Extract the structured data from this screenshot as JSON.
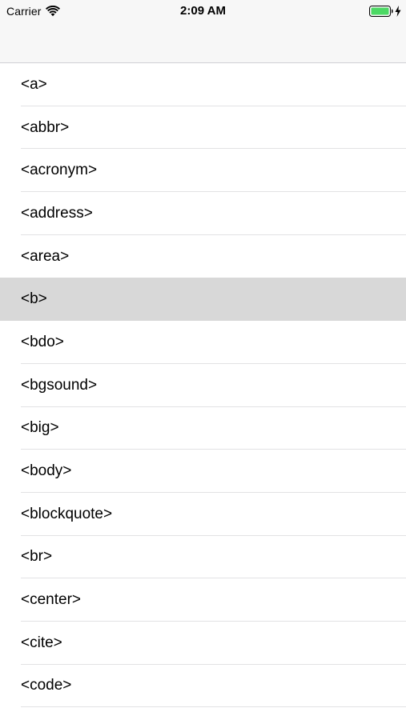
{
  "status_bar": {
    "carrier": "Carrier",
    "time": "2:09 AM",
    "icons": {
      "wifi": "wifi-icon",
      "battery": "battery-icon",
      "charging": "charging-bolt-icon"
    },
    "battery_color": "#4cd964"
  },
  "list": {
    "selected_index": 5,
    "selected_color": "#d8d8d8",
    "items": [
      {
        "label": "<a>"
      },
      {
        "label": "<abbr>"
      },
      {
        "label": "<acronym>"
      },
      {
        "label": "<address>"
      },
      {
        "label": "<area>"
      },
      {
        "label": "<b>"
      },
      {
        "label": "<bdo>"
      },
      {
        "label": "<bgsound>"
      },
      {
        "label": "<big>"
      },
      {
        "label": "<body>"
      },
      {
        "label": "<blockquote>"
      },
      {
        "label": "<br>"
      },
      {
        "label": "<center>"
      },
      {
        "label": "<cite>"
      },
      {
        "label": "<code>"
      }
    ]
  }
}
